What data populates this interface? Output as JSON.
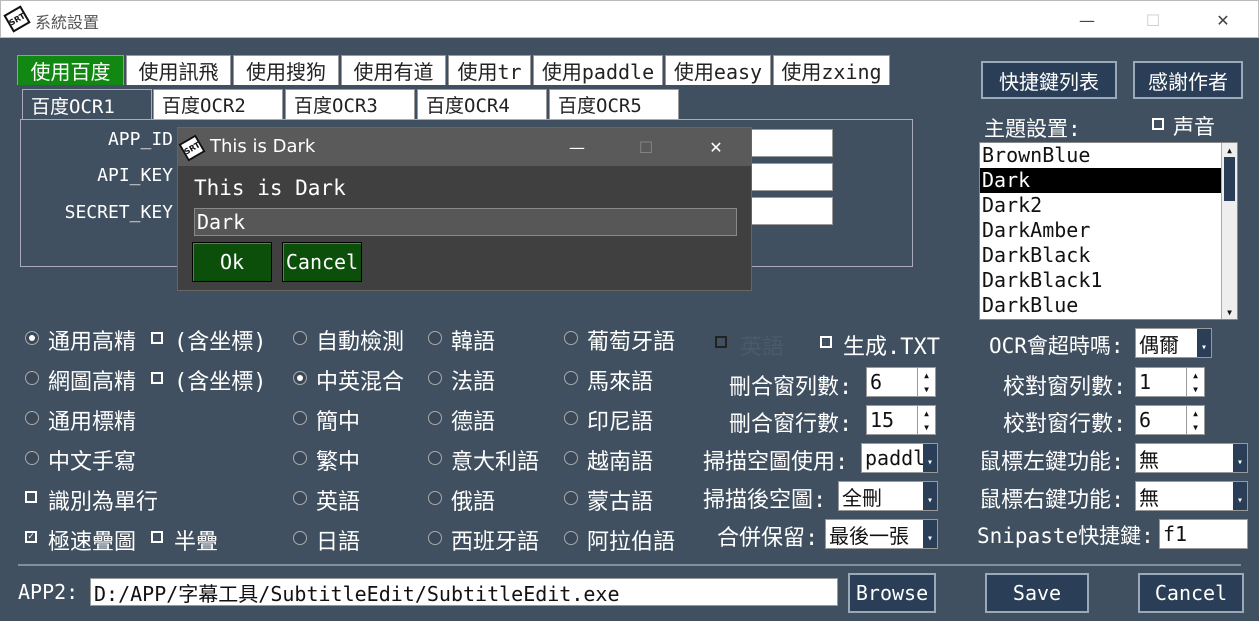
{
  "window": {
    "title": "系統設置",
    "minimize": "—",
    "maximize": "☐",
    "close": "✕",
    "icon_text": "SRT"
  },
  "engine_tabs": [
    "使用百度",
    "使用訊飛",
    "使用搜狗",
    "使用有道",
    "使用tr",
    "使用paddle",
    "使用easy",
    "使用zxing"
  ],
  "ocr_tabs": [
    "百度OCR1",
    "百度OCR2",
    "百度OCR3",
    "百度OCR4",
    "百度OCR5"
  ],
  "fields": {
    "app_id": "APP_ID",
    "api_key": "API_KEY",
    "secret_key": "SECRET_KEY"
  },
  "top_buttons": {
    "shortcuts": "快捷鍵列表",
    "thanks": "感謝作者"
  },
  "theme": {
    "label": "主題設置:",
    "sound_label": "声音",
    "items": [
      "BrownBlue",
      "Dark",
      "Dark2",
      "DarkAmber",
      "DarkBlack",
      "DarkBlack1",
      "DarkBlue"
    ],
    "selected": "Dark"
  },
  "dialog": {
    "title": "This is Dark",
    "message": "This is Dark",
    "input_value": "Dark",
    "ok": "Ok",
    "cancel": "Cancel",
    "icon_text": "SRT"
  },
  "ocr_modes": {
    "general_accurate": "通用高精",
    "with_coords": "(含坐標)",
    "web_image": "網圖高精",
    "general_standard": "通用標精",
    "chinese_handwriting": "中文手寫",
    "single_line": "識別為單行",
    "fast_stack": "極速疊圖",
    "half_stack": "半疊"
  },
  "languages": {
    "col1": [
      "自動檢測",
      "中英混合",
      "簡中",
      "繁中",
      "英語",
      "日語"
    ],
    "col2": [
      "韓語",
      "法語",
      "德語",
      "意大利語",
      "俄語",
      "西班牙語"
    ],
    "col3": [
      "葡萄牙語",
      "馬來語",
      "印尼語",
      "越南語",
      "蒙古語",
      "阿拉伯語"
    ]
  },
  "options": {
    "english_label": "英語",
    "gen_txt_label": "生成.TXT",
    "del_cols_label": "刪合窗列數:",
    "del_cols_value": "6",
    "del_rows_label": "刪合窗行數:",
    "del_rows_value": "15",
    "scan_blank_label": "掃描空圖使用:",
    "scan_blank_value": "paddle",
    "after_blank_label": "掃描後空圖:",
    "after_blank_value": "全刪",
    "merge_keep_label": "合併保留:",
    "merge_keep_value": "最後一張",
    "timeout_label": "OCR會超時嗎:",
    "timeout_value": "偶爾",
    "proof_cols_label": "校對窗列數:",
    "proof_cols_value": "1",
    "proof_rows_label": "校對窗行數:",
    "proof_rows_value": "6",
    "mouse_left_label": "鼠標左鍵功能:",
    "mouse_left_value": "無",
    "mouse_right_label": "鼠標右鍵功能:",
    "mouse_right_value": "無",
    "snipaste_label": "Snipaste快捷鍵:",
    "snipaste_value": "f1"
  },
  "bottom": {
    "app2_label": "APP2:",
    "app2_value": "D:/APP/字幕工具/SubtitleEdit/SubtitleEdit.exe",
    "browse": "Browse",
    "save": "Save",
    "cancel": "Cancel"
  },
  "colors": {
    "background": "#405060",
    "active_tab": "#118811",
    "dialog_button": "#0b4f0b",
    "button": "#2a3f57"
  }
}
